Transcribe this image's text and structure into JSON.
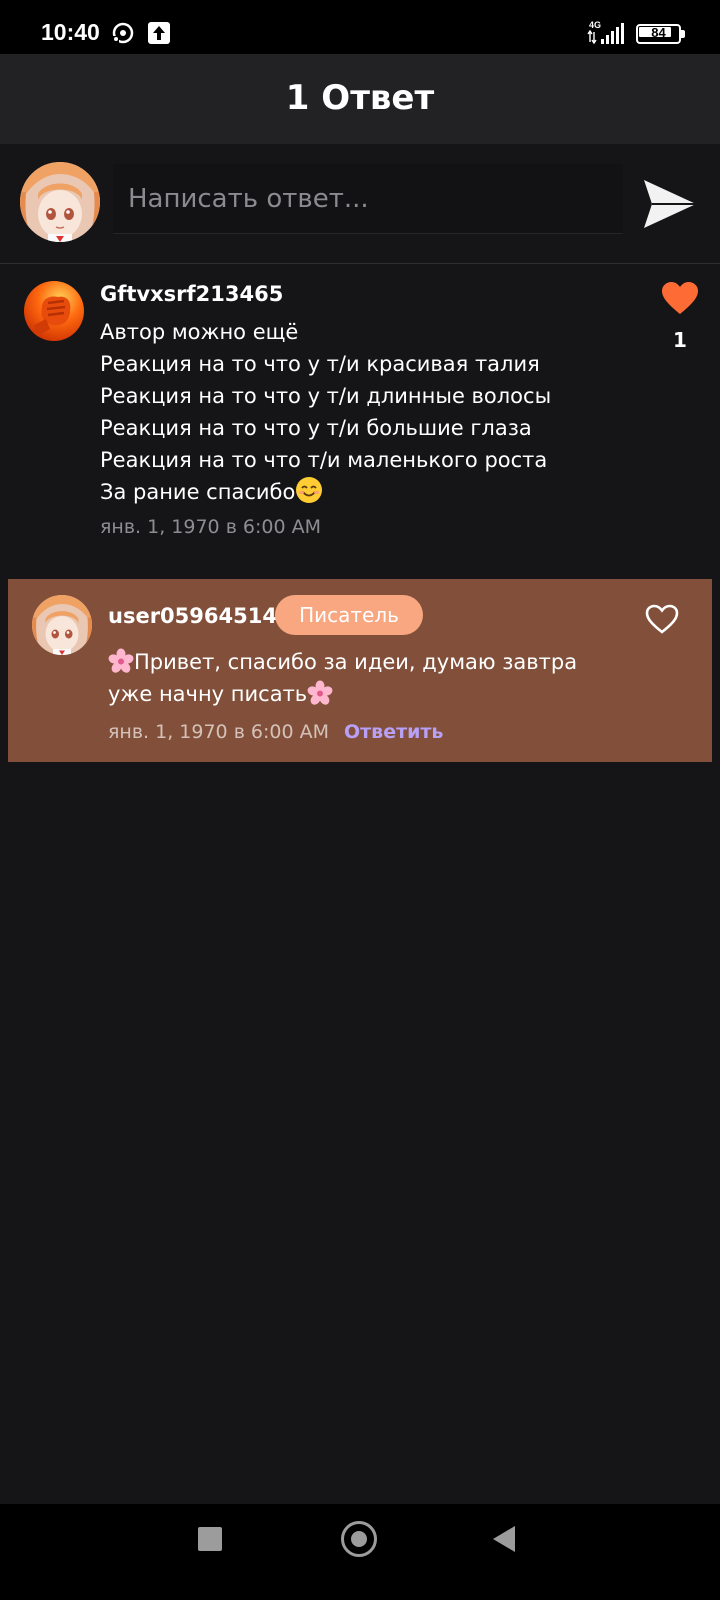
{
  "status_bar": {
    "time": "10:40",
    "network": "4G",
    "battery": "84",
    "icons": [
      "cast-icon",
      "upload-icon",
      "signal-icon",
      "battery-icon"
    ]
  },
  "header": {
    "title": "1 Ответ"
  },
  "composer": {
    "placeholder": "Написать ответ...",
    "avatar_icon": "anime-girl-avatar",
    "send_icon": "send-icon"
  },
  "comment": {
    "author": "Gftvxsrf213465",
    "avatar_icon": "orange-fist-avatar",
    "lines": [
      "Автор можно ещё",
      "Реакция на то что у т/и красивая талия",
      "Реакция на то что у т/и длинные волосы",
      "Реакция на то что у т/и большие глаза",
      "Реакция на то что т/и маленького роста",
      "За рание спасибо"
    ],
    "trailing_emoji": "smiling-face-emoji",
    "time": "янв. 1, 1970 в 6:00 AM",
    "likes": "1",
    "like_icon": "heart-filled-icon",
    "like_color": "#ff6b35"
  },
  "reply": {
    "author": "user05964514",
    "badge": "Писатель",
    "avatar_icon": "anime-girl-avatar",
    "lines": [
      "Привет, спасибо за идеи, думаю завтра",
      "уже начну писать"
    ],
    "emoji": "cherry-blossom-emoji",
    "time": "янв. 1, 1970 в 6:00 AM",
    "action": "Ответить",
    "like_icon": "heart-outline-icon",
    "background_color": "#82503a",
    "badge_color": "#f8a781",
    "action_color": "#b7a0f6"
  },
  "nav_bar": {
    "buttons": [
      "recents-button",
      "home-button",
      "back-button"
    ]
  }
}
